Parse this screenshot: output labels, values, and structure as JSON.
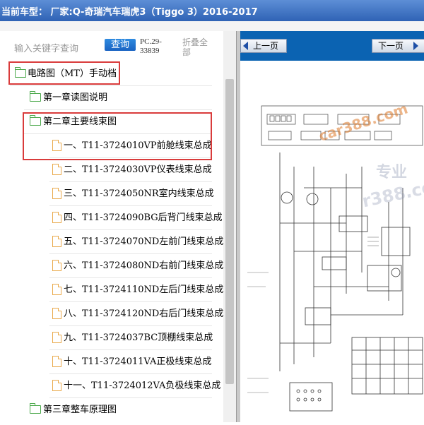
{
  "window": {
    "title": "当前车型：  厂家:Q-奇瑞汽车瑞虎3（Tiggo 3）2016-2017"
  },
  "search": {
    "placeholder": "输入关键字查询",
    "button_label": "查询",
    "code": "PC.29-33839",
    "collapse_label": "折叠全部"
  },
  "tree": {
    "root": "电路图（MT）手动档",
    "chapter1": "第一章读图说明",
    "chapter2": "第二章主要线束图",
    "items": [
      "一、T11-3724010VP前舱线束总成",
      "二、T11-3724030VP仪表线束总成",
      "三、T11-3724050NR室内线束总成",
      "四、T11-3724090BG后背门线束总成",
      "五、T11-3724070ND左前门线束总成",
      "六、T11-3724080ND右前门线束总成",
      "七、T11-3724110ND左后门线束总成",
      "八、T11-3724120ND右后门线束总成",
      "九、T11-3724037BC顶棚线束总成",
      "十、T11-3724011VA正极线束总成",
      "十一、T11-3724012VA负极线束总成"
    ],
    "chapter3": "第三章整车原理图"
  },
  "viewer": {
    "prev_label": "上一页",
    "next_label": "下一页",
    "watermark_main": "car388.com",
    "watermark_cn": "专业",
    "watermark_side": "r388.co"
  },
  "colors": {
    "titlebar": "#2f63b5",
    "highlight": "#d93b3b",
    "folder": "#4aa84a",
    "file": "#e9a94a",
    "navbar": "#0b63b2"
  }
}
